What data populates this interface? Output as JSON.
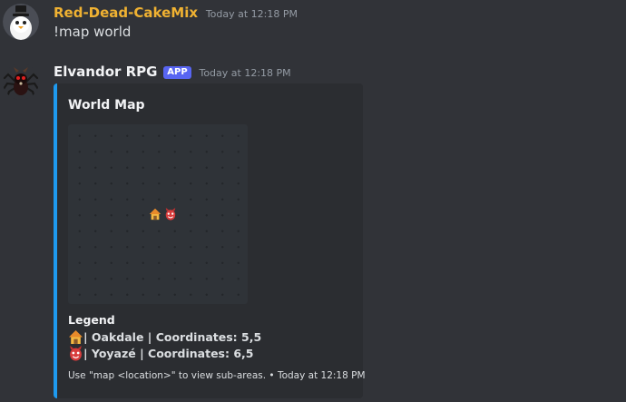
{
  "messages": [
    {
      "author": "Red-Dead-CakeMix",
      "author_color": "#f0b232",
      "timestamp": "Today at 12:18 PM",
      "content": "!map world"
    },
    {
      "author": "Elvandor RPG",
      "author_color": "#f2f3f5",
      "badge": "APP",
      "timestamp": "Today at 12:18 PM",
      "embed": {
        "accent_color": "#1e9aef",
        "title": "World Map",
        "map_markers": [
          {
            "name": "house-icon",
            "location": "Oakdale"
          },
          {
            "name": "demon-face-icon",
            "location": "Yoyazé"
          }
        ],
        "legend_title": "Legend",
        "legend": [
          {
            "icon": "house-icon",
            "text": "| Oakdale | Coordinates: 5,5"
          },
          {
            "icon": "demon-face-icon",
            "text": "| Yoyazé | Coordinates: 6,5"
          }
        ],
        "footer": "Use \"map <location>\" to view sub-areas. • Today at 12:18 PM"
      }
    }
  ]
}
